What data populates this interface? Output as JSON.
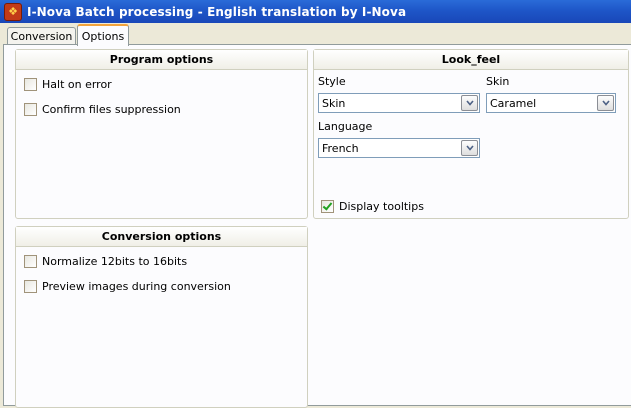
{
  "window": {
    "title": "I-Nova Batch processing - English translation by I-Nova",
    "app_icon": "app-icon"
  },
  "tabs": [
    {
      "label": "Conversion",
      "selected": false
    },
    {
      "label": "Options",
      "selected": true
    }
  ],
  "program_options": {
    "title": "Program options",
    "halt_on_error": {
      "label": "Halt on error",
      "checked": false
    },
    "confirm_files_suppression": {
      "label": "Confirm files suppression",
      "checked": false
    }
  },
  "look_feel": {
    "title": "Look_feel",
    "style_label": "Style",
    "style_value": "Skin",
    "skin_label": "Skin",
    "skin_value": "Caramel",
    "language_label": "Language",
    "language_value": "French",
    "display_tooltips": {
      "label": "Display tooltips",
      "checked": true
    }
  },
  "conversion_options": {
    "title": "Conversion options",
    "normalize": {
      "label": "Normalize 12bits to 16bits",
      "checked": false
    },
    "preview": {
      "label": "Preview images during conversion",
      "checked": false
    }
  },
  "colors": {
    "titlebar": "#1e56c8",
    "tab_accent": "#f2a33c",
    "panel_bg": "#fcfcfe",
    "dialog_bg": "#ece9d8"
  }
}
